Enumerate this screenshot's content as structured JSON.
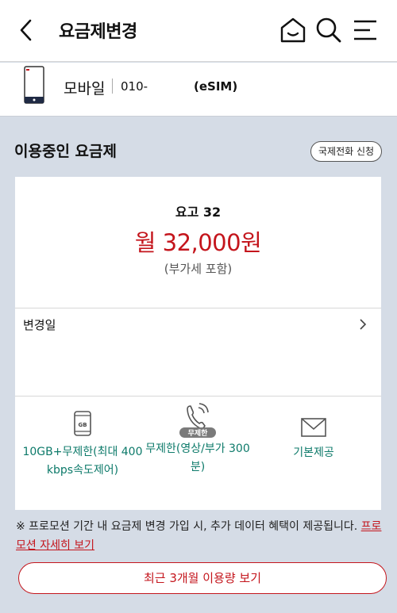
{
  "header": {
    "title": "요금제변경",
    "back_icon": "chevron-left-icon",
    "home_icon": "home-icon",
    "search_icon": "search-icon",
    "menu_icon": "menu-icon"
  },
  "device": {
    "type": "모바일",
    "number": "010-",
    "sim_type": "(eSIM)"
  },
  "section": {
    "title": "이용중인 요금제",
    "intl_button": "국제전화 신청"
  },
  "plan": {
    "name": "요고 32",
    "price": "월 32,000원",
    "vat": "(부가세 포함)",
    "change_date_label": "변경일"
  },
  "features": [
    {
      "icon": "data-gb-icon",
      "icon_text": "GB",
      "text": "10GB+무제한(최대 400 kbps속도제어)"
    },
    {
      "icon": "phone-call-icon",
      "badge": "무제한",
      "text": "무제한(영상/부가 300 분)"
    },
    {
      "icon": "envelope-icon",
      "text": "기본제공"
    }
  ],
  "notice": {
    "prefix": "※ 프로모션 기간 내 요금제 변경 가입 시, 추가 데이터 혜택이 제공됩니다. ",
    "link": "프로모션 자세히 보기"
  },
  "usage_button": "최근 3개월 이용량 보기",
  "colors": {
    "accent": "#c4151c",
    "feature_text": "#0d7a6a",
    "background": "#d5dce6"
  }
}
